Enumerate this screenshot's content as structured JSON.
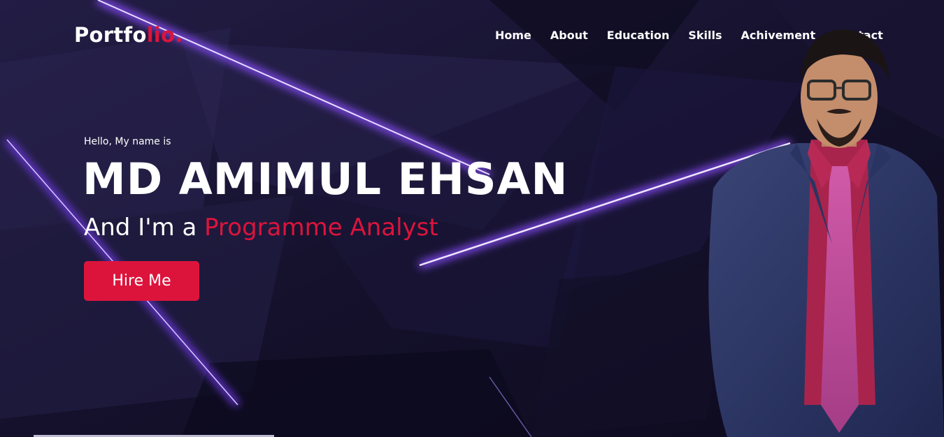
{
  "nav": {
    "logo_main": "Portfo",
    "logo_accent": "lio.",
    "items": [
      "Home",
      "About",
      "Education",
      "Skills",
      "Achivement",
      "Contact"
    ]
  },
  "hero": {
    "greeting": "Hello, My name is",
    "name": "MD AMIMUL EHSAN",
    "role_prefix": "And I'm a ",
    "role_highlight": "Programme Analyst",
    "cta_label": "Hire Me"
  },
  "colors": {
    "accent": "#dc143c",
    "background": "#14112a",
    "glow": "#8a4dff"
  }
}
